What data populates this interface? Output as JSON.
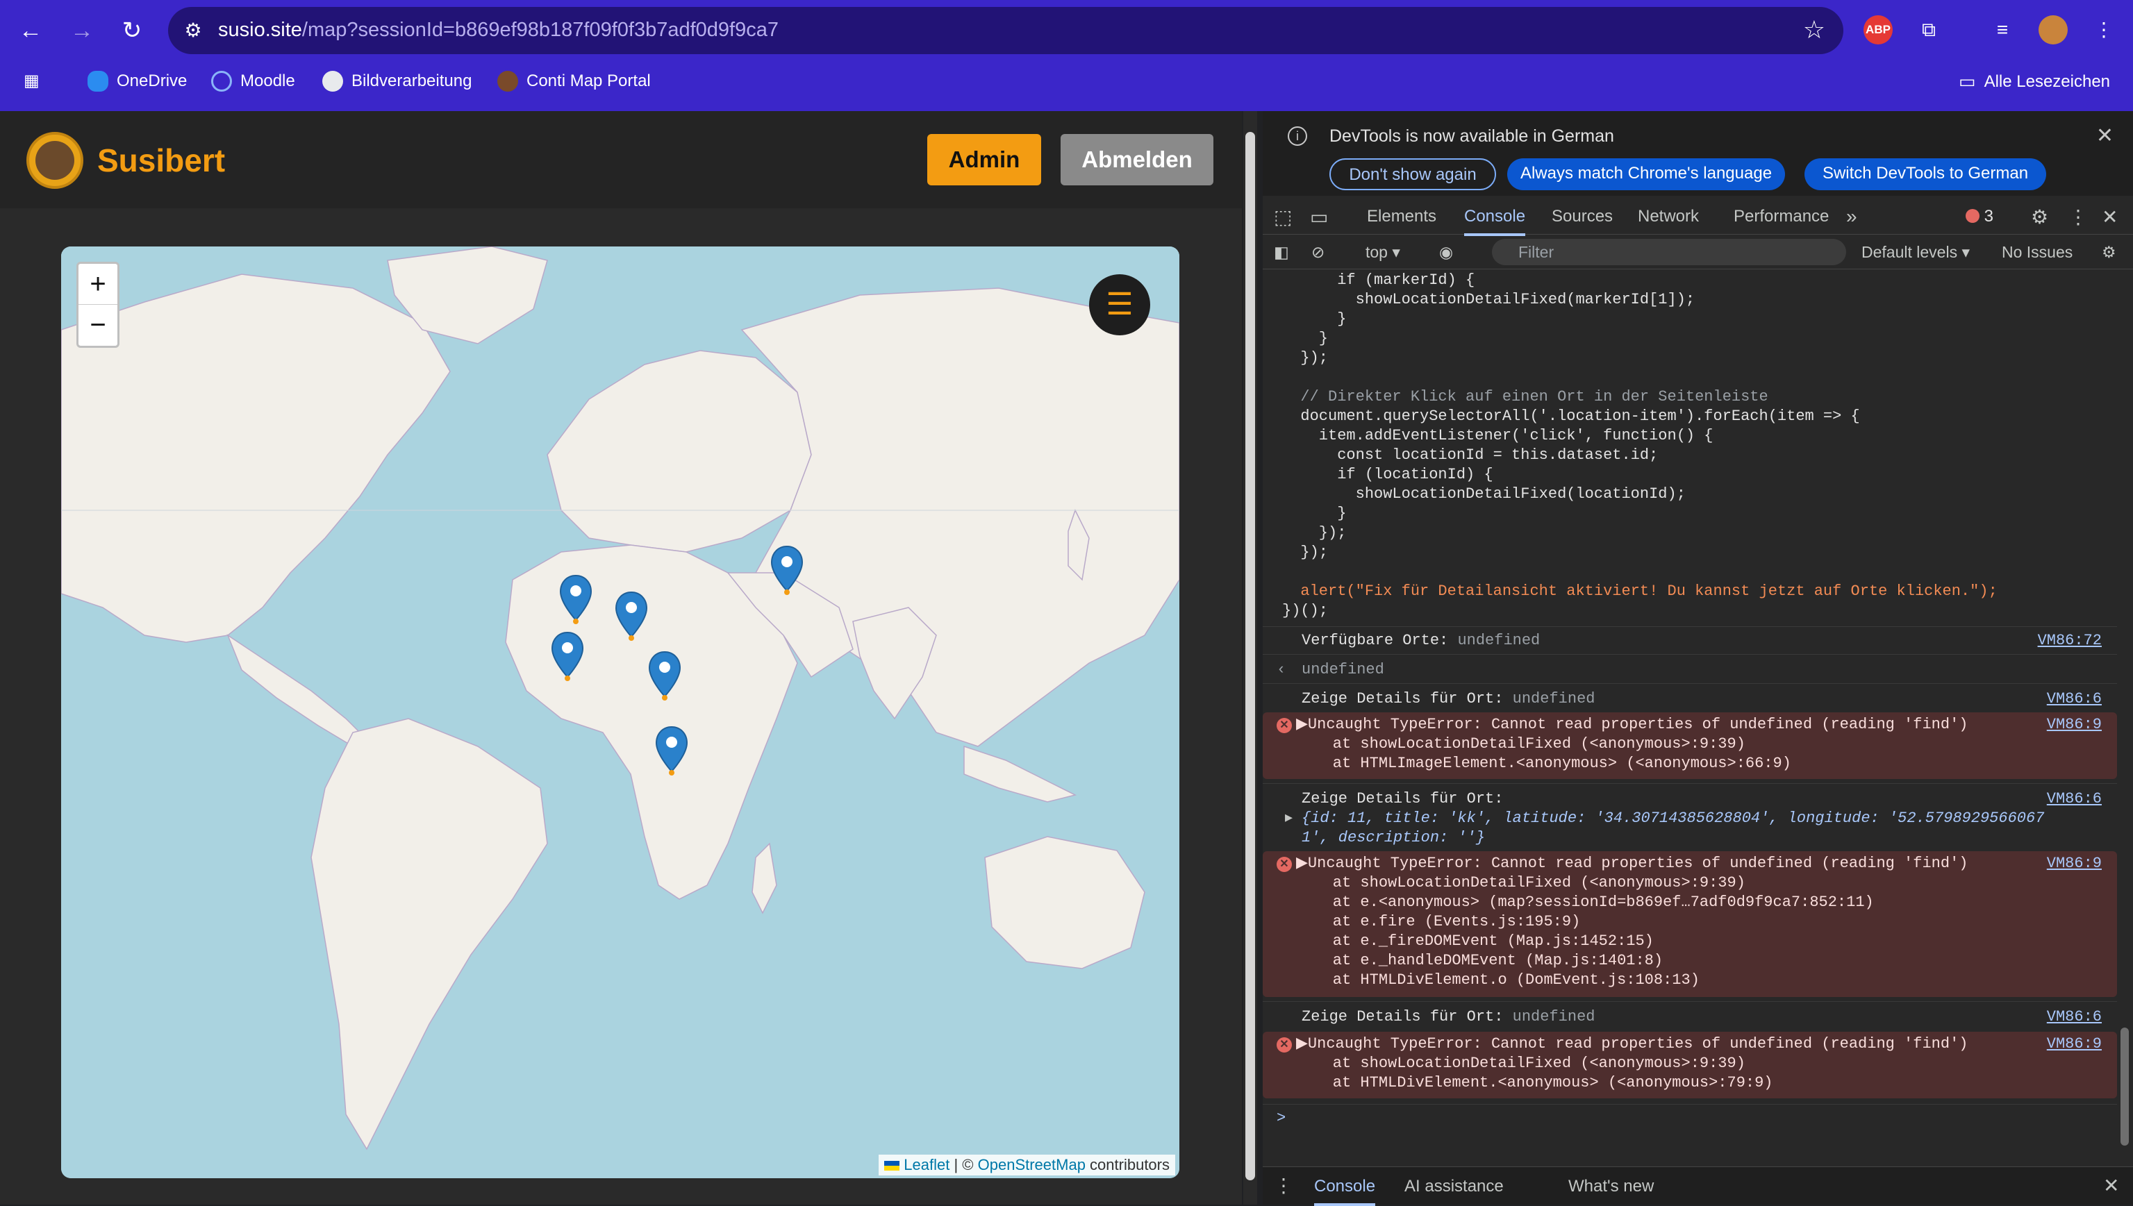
{
  "browser": {
    "url_host": "susio.site",
    "url_path": "/map?sessionId=b869ef98b187f09f0f3b7adf0d9f9ca7",
    "bookmarks": [
      "OneDrive",
      "Moodle",
      "Bildverarbeitung",
      "Conti Map Portal"
    ],
    "all_bookmarks_label": "Alle Lesezeichen",
    "extension_abp": "ABP"
  },
  "app": {
    "brand": "Susibert",
    "admin_label": "Admin",
    "logout_label": "Abmelden",
    "zoom_in": "+",
    "zoom_out": "−",
    "menu_icon": "☰",
    "attribution": {
      "leaflet": "Leaflet",
      "sep": " | © ",
      "osm": "OpenStreetMap",
      "contributors": " contributors"
    },
    "accent_color": "#f39c12",
    "marker_color": "#2a81cb"
  },
  "devtools": {
    "info_text": "DevTools is now available in German",
    "btn_dont_show": "Don't show again",
    "btn_match": "Always match Chrome's language",
    "btn_switch": "Switch DevTools to German",
    "tabs": [
      "Elements",
      "Console",
      "Sources",
      "Network",
      "Performance"
    ],
    "active_tab": "Console",
    "error_count": "3",
    "context": "top ▾",
    "filter_placeholder": "Filter",
    "levels": "Default levels ▾",
    "issues": "No Issues",
    "code": [
      "      if (markerId) {",
      "        showLocationDetailFixed(markerId[1]);",
      "      }",
      "    }",
      "  });",
      "",
      "  // Direkter Klick auf einen Ort in der Seitenleiste",
      "  document.querySelectorAll('.location-item').forEach(item => {",
      "    item.addEventListener('click', function() {",
      "      const locationId = this.dataset.id;",
      "      if (locationId) {",
      "        showLocationDetailFixed(locationId);",
      "      }",
      "    });",
      "  });",
      "",
      "  alert(\"Fix für Detailansicht aktiviert! Du kannst jetzt auf Orte klicken.\");",
      "})();"
    ],
    "log_available_label": "Verfügbare Orte: ",
    "log_available_value": "undefined",
    "log_available_src": "VM86:72",
    "return_value": "undefined",
    "log_details_label": "Zeige Details für Ort: ",
    "log_details_value": "undefined",
    "src_vm6": "VM86:6",
    "src_vm9": "VM86:9",
    "error_msg": "▶Uncaught TypeError: Cannot read properties of undefined (reading 'find')",
    "err1_lines": [
      "    at showLocationDetailFixed (<anonymous>:9:39)",
      "    at HTMLImageElement.<anonymous> (<anonymous>:66:9)"
    ],
    "obj_line1": "{id: 11, title: 'kk', latitude: '34.30714385628804', longitude: '52.5798929566067",
    "obj_line2": "1', description: ''}",
    "err2_lines": [
      "    at showLocationDetailFixed (<anonymous>:9:39)",
      "    at e.<anonymous> (map?sessionId=b869ef…7adf0d9f9ca7:852:11)",
      "    at e.fire (Events.js:195:9)",
      "    at e._fireDOMEvent (Map.js:1452:15)",
      "    at e._handleDOMEvent (Map.js:1401:8)",
      "    at HTMLDivElement.o (DomEvent.js:108:13)"
    ],
    "err3_lines": [
      "    at showLocationDetailFixed (<anonymous>:9:39)",
      "    at HTMLDivElement.<anonymous> (<anonymous>:79:9)"
    ],
    "prompt": ">",
    "drawer_tabs": [
      "Console",
      "AI assistance",
      "What's new"
    ]
  }
}
